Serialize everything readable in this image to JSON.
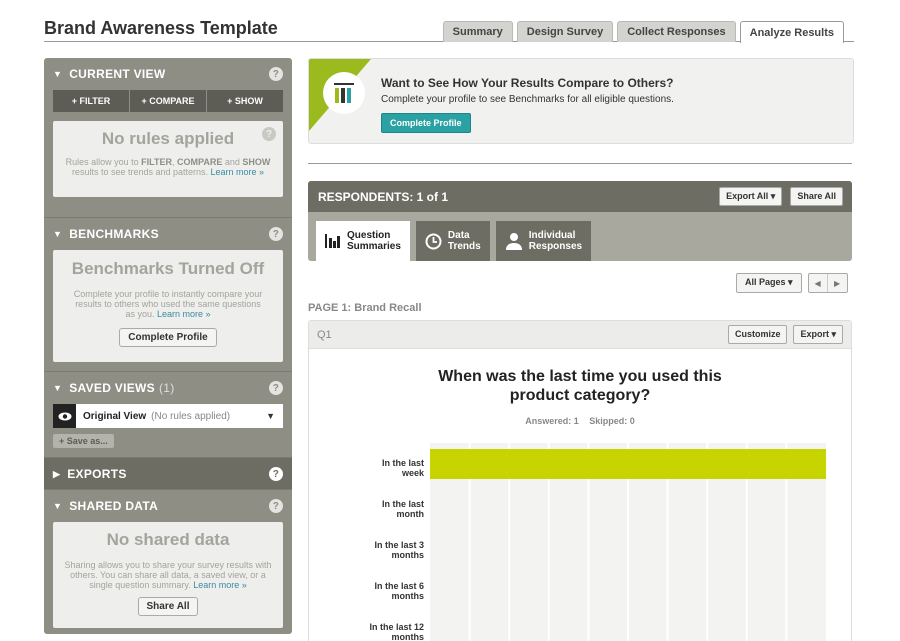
{
  "app": {
    "title": "Brand Awareness Template"
  },
  "tabs": [
    {
      "label": "Summary"
    },
    {
      "label": "Design Survey"
    },
    {
      "label": "Collect Responses"
    },
    {
      "label": "Analyze Results"
    }
  ],
  "sidebar": {
    "current_view": {
      "title": "CURRENT VIEW",
      "filter_label": "+ FILTER",
      "compare_label": "+ COMPARE",
      "show_label": "+ SHOW",
      "empty_title": "No rules applied",
      "empty_text_1": "Rules allow you to ",
      "filter_word": "FILTER",
      "sep1": ", ",
      "compare_word": "COMPARE",
      "sep2": " and ",
      "show_word": "SHOW",
      "empty_text_2": "results to see trends and patterns.",
      "learn_more": "Learn more »"
    },
    "benchmarks": {
      "title": "BENCHMARKS",
      "empty_title": "Benchmarks Turned Off",
      "empty_text": "Complete your profile to instantly compare your results to others who used the same questions as you.",
      "learn_more": "Learn more »",
      "button": "Complete Profile"
    },
    "saved_views": {
      "title": "SAVED VIEWS",
      "count": "(1)",
      "view_name": "Original View",
      "view_desc": "(No rules applied)",
      "save_as": "+ Save as..."
    },
    "exports": {
      "title": "EXPORTS"
    },
    "shared_data": {
      "title": "SHARED DATA",
      "empty_title": "No shared data",
      "empty_text": "Sharing allows you to share your survey results with others. You can share all data, a saved view, or a single question summary.",
      "learn_more": "Learn more »",
      "button": "Share All"
    },
    "help_label": "?"
  },
  "promo": {
    "heading": "Want to See How Your Results Compare to Others?",
    "text": "Complete your profile to see Benchmarks for all eligible questions.",
    "button": "Complete Profile"
  },
  "respondents": {
    "label": "RESPONDENTS: 1 of 1",
    "export_all": "Export All ▾",
    "share_all": "Share All",
    "tabs": [
      {
        "line1": "Question",
        "line2": "Summaries"
      },
      {
        "line1": "Data",
        "line2": "Trends"
      },
      {
        "line1": "Individual",
        "line2": "Responses"
      }
    ]
  },
  "pagination": {
    "all_pages": "All Pages ▾",
    "prev": "◀",
    "next": "▶"
  },
  "page": {
    "title": "PAGE 1: Brand Recall"
  },
  "question": {
    "number": "Q1",
    "customize": "Customize",
    "export": "Export ▾",
    "title_line1": "When was the last time you used this",
    "title_line2": "product category?",
    "answered": "Answered: 1",
    "skipped": "Skipped: 0"
  },
  "chart_data": {
    "type": "bar",
    "orientation": "horizontal",
    "categories": [
      [
        "In the last",
        "week"
      ],
      [
        "In the last",
        "month"
      ],
      [
        "In the last 3",
        "months"
      ],
      [
        "In the last 6",
        "months"
      ],
      [
        "In the last 12",
        "months"
      ]
    ],
    "values": [
      100,
      0,
      0,
      0,
      0
    ],
    "xlim": [
      0,
      100
    ],
    "gridlines": 10,
    "grid": true,
    "bar_color": "#c8d400"
  }
}
